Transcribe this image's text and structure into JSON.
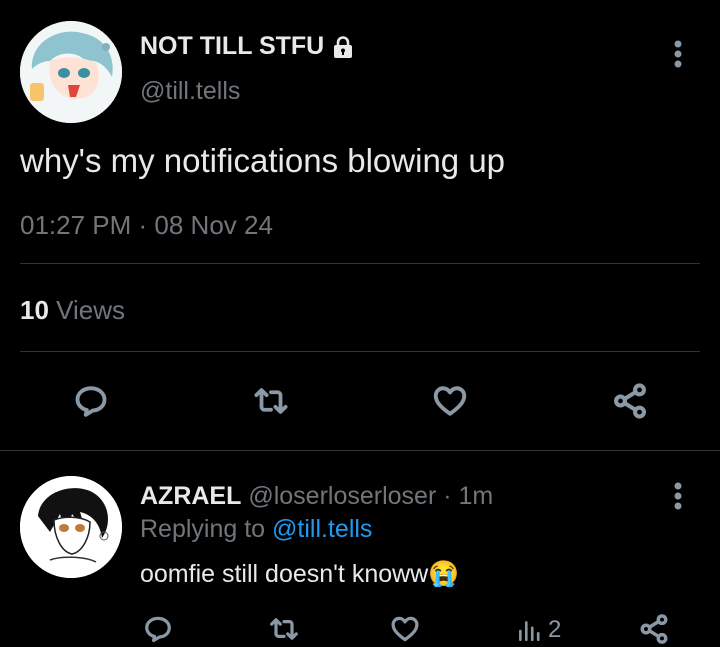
{
  "tweet": {
    "display_name": "NOT TILL STFU",
    "handle": "@till.tells",
    "text": "why's my notifications blowing up",
    "timestamp": "01:27 PM · 08 Nov 24",
    "views_count": "10",
    "views_label": "Views"
  },
  "reply": {
    "display_name": "AZRAEL",
    "handle": "@loserloserloser",
    "separator": "·",
    "time": "1m",
    "replying_label": "Replying to",
    "replying_handle": "@till.tells",
    "text": "oomfie still doesn't knoww",
    "emoji": "😭",
    "views_count": "2"
  },
  "icons": {
    "reply": "comment-icon",
    "retweet": "retweet-icon",
    "like": "heart-icon",
    "share": "share-icon",
    "views": "bar-chart-icon",
    "more": "more-vertical-icon",
    "lock": "lock-icon"
  },
  "colors": {
    "background": "#000000",
    "text": "#e7e9ea",
    "muted": "#71767b",
    "link": "#1d9bf0",
    "divider": "#2f3336"
  }
}
